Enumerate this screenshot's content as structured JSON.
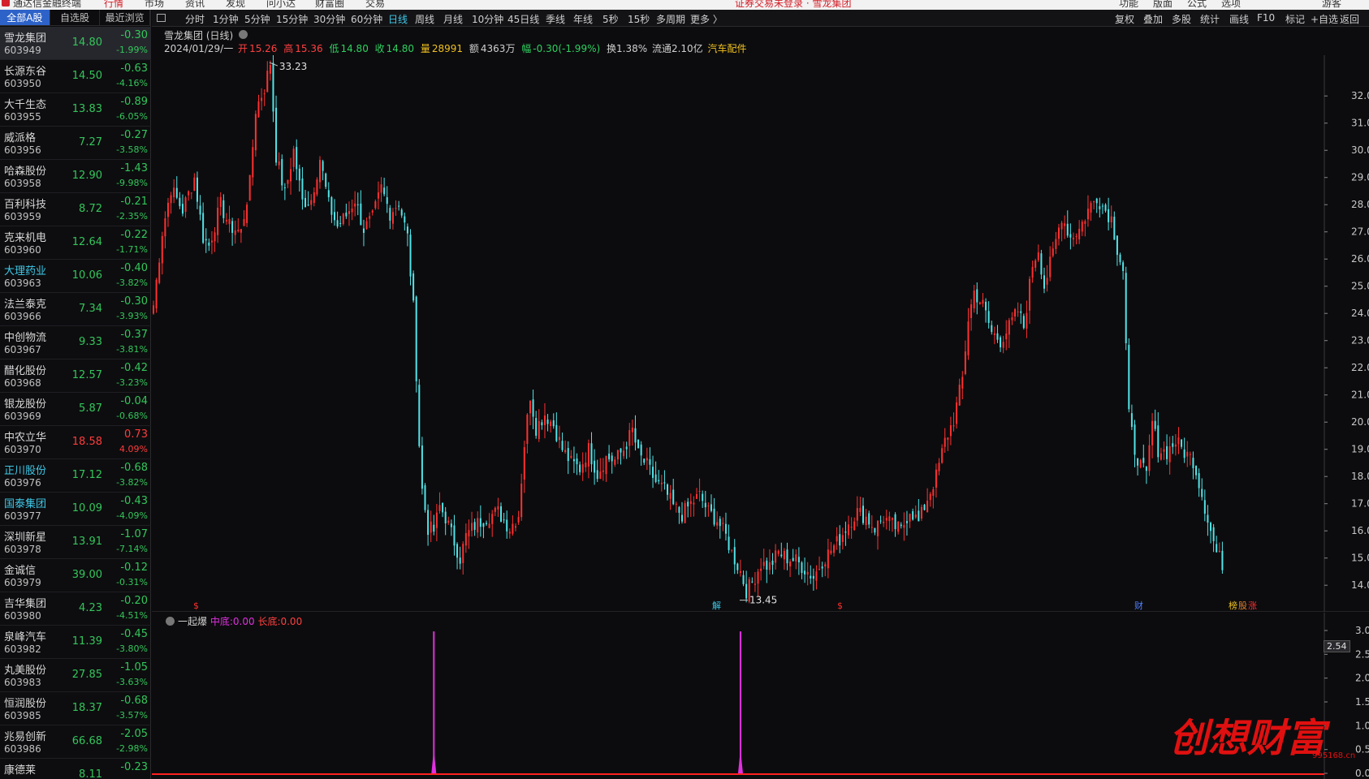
{
  "topbar": {
    "items": [
      "行情",
      "市场",
      "资讯",
      "发现",
      "问小达",
      "财富圈",
      "交易"
    ],
    "app_title": "通达信金融终端",
    "center_text": "证券交易未登录 · 雪龙集团",
    "right_items": [
      "功能",
      "版面",
      "公式",
      "选项",
      "游客"
    ]
  },
  "left_tabs": [
    "全部A股",
    "自选股",
    "最近浏览"
  ],
  "stocks": [
    {
      "name": "雪龙集团",
      "code": "603949",
      "price": "14.80",
      "change": "-0.30",
      "pct": "-1.99%",
      "up": false,
      "blue": false,
      "selected": true
    },
    {
      "name": "长源东谷",
      "code": "603950",
      "price": "14.50",
      "change": "-0.63",
      "pct": "-4.16%",
      "up": false,
      "blue": false
    },
    {
      "name": "大千生态",
      "code": "603955",
      "price": "13.83",
      "change": "-0.89",
      "pct": "-6.05%",
      "up": false,
      "blue": false
    },
    {
      "name": "威派格",
      "code": "603956",
      "price": "7.27",
      "change": "-0.27",
      "pct": "-3.58%",
      "up": false,
      "blue": false
    },
    {
      "name": "哈森股份",
      "code": "603958",
      "price": "12.90",
      "change": "-1.43",
      "pct": "-9.98%",
      "up": false,
      "blue": false
    },
    {
      "name": "百利科技",
      "code": "603959",
      "price": "8.72",
      "change": "-0.21",
      "pct": "-2.35%",
      "up": false,
      "blue": false
    },
    {
      "name": "克来机电",
      "code": "603960",
      "price": "12.64",
      "change": "-0.22",
      "pct": "-1.71%",
      "up": false,
      "blue": false
    },
    {
      "name": "大理药业",
      "code": "603963",
      "price": "10.06",
      "change": "-0.40",
      "pct": "-3.82%",
      "up": false,
      "blue": true
    },
    {
      "name": "法兰泰克",
      "code": "603966",
      "price": "7.34",
      "change": "-0.30",
      "pct": "-3.93%",
      "up": false,
      "blue": false
    },
    {
      "name": "中创物流",
      "code": "603967",
      "price": "9.33",
      "change": "-0.37",
      "pct": "-3.81%",
      "up": false,
      "blue": false
    },
    {
      "name": "醋化股份",
      "code": "603968",
      "price": "12.57",
      "change": "-0.42",
      "pct": "-3.23%",
      "up": false,
      "blue": false
    },
    {
      "name": "银龙股份",
      "code": "603969",
      "price": "5.87",
      "change": "-0.04",
      "pct": "-0.68%",
      "up": false,
      "blue": false
    },
    {
      "name": "中农立华",
      "code": "603970",
      "price": "18.58",
      "change": "0.73",
      "pct": "4.09%",
      "up": true,
      "blue": false
    },
    {
      "name": "正川股份",
      "code": "603976",
      "price": "17.12",
      "change": "-0.68",
      "pct": "-3.82%",
      "up": false,
      "blue": true
    },
    {
      "name": "国泰集团",
      "code": "603977",
      "price": "10.09",
      "change": "-0.43",
      "pct": "-4.09%",
      "up": false,
      "blue": true
    },
    {
      "name": "深圳新星",
      "code": "603978",
      "price": "13.91",
      "change": "-1.07",
      "pct": "-7.14%",
      "up": false,
      "blue": false
    },
    {
      "name": "金诚信",
      "code": "603979",
      "price": "39.00",
      "change": "-0.12",
      "pct": "-0.31%",
      "up": false,
      "blue": false
    },
    {
      "name": "吉华集团",
      "code": "603980",
      "price": "4.23",
      "change": "-0.20",
      "pct": "-4.51%",
      "up": false,
      "blue": false
    },
    {
      "name": "泉峰汽车",
      "code": "603982",
      "price": "11.39",
      "change": "-0.45",
      "pct": "-3.80%",
      "up": false,
      "blue": false
    },
    {
      "name": "丸美股份",
      "code": "603983",
      "price": "27.85",
      "change": "-1.05",
      "pct": "-3.63%",
      "up": false,
      "blue": false
    },
    {
      "name": "恒润股份",
      "code": "603985",
      "price": "18.37",
      "change": "-0.68",
      "pct": "-3.57%",
      "up": false,
      "blue": false
    },
    {
      "name": "兆易创新",
      "code": "603986",
      "price": "66.68",
      "change": "-2.05",
      "pct": "-2.98%",
      "up": false,
      "blue": false
    },
    {
      "name": "康德莱",
      "code": "",
      "price": "8.11",
      "change": "-0.23",
      "pct": "",
      "up": false,
      "blue": false
    }
  ],
  "toolbar": {
    "periods": [
      "分时",
      "1分钟",
      "5分钟",
      "15分钟",
      "30分钟",
      "60分钟",
      "日线",
      "周线",
      "月线",
      "10分钟",
      "45日线",
      "季线",
      "年线",
      "5秒",
      "15秒",
      "多周期",
      "更多 〉"
    ],
    "active_period": "日线",
    "right": [
      "复权",
      "叠加",
      "多股",
      "统计",
      "画线",
      "F10",
      "标记",
      "+自选",
      "返回"
    ]
  },
  "chart_header": {
    "title": "雪龙集团 (日线)",
    "date": "2024/01/29/一",
    "open_label": "开",
    "open": "15.26",
    "high_label": "高",
    "high": "15.36",
    "low_label": "低",
    "low": "14.80",
    "close_label": "收",
    "close": "14.80",
    "vol_label": "量",
    "vol": "28991",
    "amt_label": "额",
    "amt": "4363万",
    "range_label": "幅",
    "range": "-0.30(-1.99%)",
    "turnover": "换1.38%",
    "float_cap": "流通2.10亿",
    "sector": "汽车配件"
  },
  "indicator": {
    "name": "一起爆",
    "mid_label": "中底:",
    "mid_value": "0.00",
    "long_label": "长底:",
    "long_value": "0.00",
    "current": "2.54",
    "colors": {
      "signal": "#e030e0",
      "baseline": "#ff2020"
    }
  },
  "events": [
    {
      "label": "$",
      "color": "#ff3030"
    },
    {
      "label": "解",
      "color": "#3ec9e8"
    },
    {
      "label": "$",
      "color": "#ff3030"
    },
    {
      "label": "财",
      "color": "#5080ff"
    },
    {
      "label": "榜",
      "color": "#f0c020"
    },
    {
      "label": "股",
      "color": "#e08030"
    },
    {
      "label": "涨",
      "color": "#ff3030"
    }
  ],
  "watermark": {
    "text": "创想财富",
    "url": "995168.cn"
  },
  "chart_data": {
    "type": "candlestick",
    "price_axis": {
      "ticks": [
        "32.00",
        "31.00",
        "30.00",
        "29.00",
        "28.00",
        "27.00",
        "26.00",
        "25.00",
        "24.00",
        "23.00",
        "22.00",
        "21.00",
        "20.00",
        "19.00",
        "18.00",
        "17.00",
        "16.00",
        "15.00",
        "14.00"
      ],
      "ylim": [
        13.2,
        33.5
      ]
    },
    "indicator_axis": {
      "ticks": [
        "3.00",
        "2.50",
        "2.00",
        "1.50",
        "1.00",
        "0.50",
        "0.00"
      ],
      "ylim": [
        0,
        3
      ]
    },
    "max_label": "33.23",
    "min_label": "13.45",
    "colors": {
      "up": "#ff3030",
      "down": "#52e4e8"
    },
    "anchors": [
      [
        0,
        24.3
      ],
      [
        3,
        27.0
      ],
      [
        6,
        28.6
      ],
      [
        10,
        27.8
      ],
      [
        14,
        29.0
      ],
      [
        17,
        26.8
      ],
      [
        19,
        26.5
      ],
      [
        23,
        28.0
      ],
      [
        26,
        27.2
      ],
      [
        30,
        27.0
      ],
      [
        33,
        28.8
      ],
      [
        35,
        31.5
      ],
      [
        38,
        32.3
      ],
      [
        40,
        33.23
      ],
      [
        42,
        29.8
      ],
      [
        45,
        28.4
      ],
      [
        48,
        30.0
      ],
      [
        51,
        28.1
      ],
      [
        54,
        28.2
      ],
      [
        57,
        29.7
      ],
      [
        60,
        28.0
      ],
      [
        63,
        27.2
      ],
      [
        66,
        27.6
      ],
      [
        69,
        28.2
      ],
      [
        72,
        27.1
      ],
      [
        75,
        27.5
      ],
      [
        78,
        28.6
      ],
      [
        81,
        27.7
      ],
      [
        84,
        28.1
      ],
      [
        87,
        26.8
      ],
      [
        89,
        24.2
      ],
      [
        90,
        21.8
      ],
      [
        91,
        19.2
      ],
      [
        92,
        17.5
      ],
      [
        94,
        16.1
      ],
      [
        96,
        16.0
      ],
      [
        98,
        16.9
      ],
      [
        100,
        16.5
      ],
      [
        102,
        15.9
      ],
      [
        105,
        15.0
      ],
      [
        107,
        15.8
      ],
      [
        110,
        16.2
      ],
      [
        114,
        16.5
      ],
      [
        118,
        16.7
      ],
      [
        122,
        16.1
      ],
      [
        125,
        16.6
      ],
      [
        127,
        19.2
      ],
      [
        129,
        21.0
      ],
      [
        131,
        19.8
      ],
      [
        134,
        20.3
      ],
      [
        137,
        19.9
      ],
      [
        140,
        19.0
      ],
      [
        143,
        18.5
      ],
      [
        146,
        18.3
      ],
      [
        149,
        19.0
      ],
      [
        152,
        18.1
      ],
      [
        155,
        18.7
      ],
      [
        158,
        18.6
      ],
      [
        161,
        19.0
      ],
      [
        164,
        19.7
      ],
      [
        166,
        18.8
      ],
      [
        169,
        18.4
      ],
      [
        172,
        17.8
      ],
      [
        175,
        17.5
      ],
      [
        178,
        16.9
      ],
      [
        181,
        16.6
      ],
      [
        184,
        17.0
      ],
      [
        187,
        17.3
      ],
      [
        190,
        16.7
      ],
      [
        193,
        16.4
      ],
      [
        196,
        15.8
      ],
      [
        198,
        15.2
      ],
      [
        201,
        14.5
      ],
      [
        203,
        13.8
      ],
      [
        205,
        14.1
      ],
      [
        208,
        14.8
      ],
      [
        211,
        14.7
      ],
      [
        214,
        15.2
      ],
      [
        217,
        15.0
      ],
      [
        220,
        14.9
      ],
      [
        223,
        14.6
      ],
      [
        226,
        14.3
      ],
      [
        229,
        14.9
      ],
      [
        232,
        15.3
      ],
      [
        235,
        15.7
      ],
      [
        238,
        16.3
      ],
      [
        241,
        16.7
      ],
      [
        244,
        16.5
      ],
      [
        247,
        16.1
      ],
      [
        250,
        16.5
      ],
      [
        253,
        16.2
      ],
      [
        256,
        16.0
      ],
      [
        259,
        16.8
      ],
      [
        262,
        16.3
      ],
      [
        265,
        17.2
      ],
      [
        268,
        18.0
      ],
      [
        271,
        19.3
      ],
      [
        274,
        20.1
      ],
      [
        277,
        21.6
      ],
      [
        279,
        23.8
      ],
      [
        281,
        24.8
      ],
      [
        284,
        24.3
      ],
      [
        287,
        23.3
      ],
      [
        290,
        23.0
      ],
      [
        293,
        23.5
      ],
      [
        296,
        24.1
      ],
      [
        298,
        23.5
      ],
      [
        301,
        25.8
      ],
      [
        303,
        26.4
      ],
      [
        305,
        25.0
      ],
      [
        308,
        26.2
      ],
      [
        311,
        27.6
      ],
      [
        314,
        26.8
      ],
      [
        317,
        27.1
      ],
      [
        320,
        27.8
      ],
      [
        323,
        28.3
      ],
      [
        326,
        27.8
      ],
      [
        328,
        27.5
      ],
      [
        330,
        26.4
      ],
      [
        332,
        25.6
      ],
      [
        333,
        22.8
      ],
      [
        334,
        20.2
      ],
      [
        336,
        19.0
      ],
      [
        338,
        18.4
      ],
      [
        340,
        18.0
      ],
      [
        342,
        20.0
      ],
      [
        344,
        19.0
      ],
      [
        347,
        18.9
      ],
      [
        350,
        19.3
      ],
      [
        353,
        18.9
      ],
      [
        356,
        18.6
      ],
      [
        358,
        17.8
      ],
      [
        360,
        16.9
      ],
      [
        362,
        16.0
      ],
      [
        364,
        15.2
      ],
      [
        366,
        14.8
      ]
    ],
    "indicator_spikes": [
      {
        "bar": 96,
        "value": 2.98
      },
      {
        "bar": 201,
        "value": 2.98
      }
    ],
    "bar_count": 367
  }
}
